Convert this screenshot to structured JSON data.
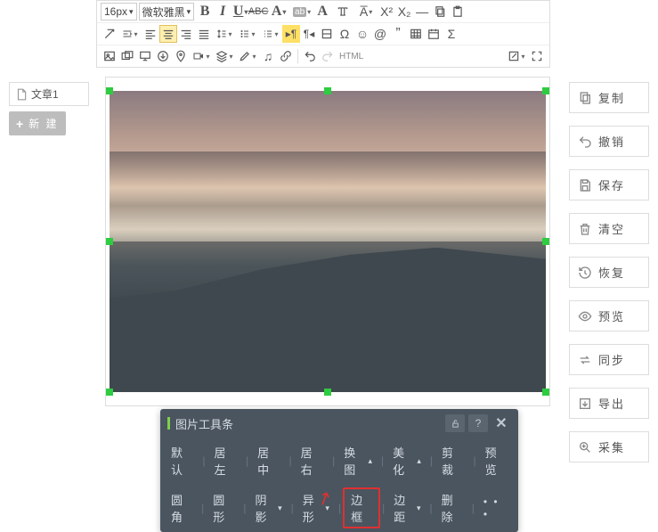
{
  "toolbar": {
    "font_size": "16px",
    "font_family": "微软雅黑",
    "html_label": "HTML"
  },
  "left": {
    "doc_tab": "文章1",
    "new_btn": "新 建"
  },
  "right": {
    "copy": "复制",
    "undo": "撤销",
    "save": "保存",
    "clear": "清空",
    "restore": "恢复",
    "preview": "预览",
    "sync": "同步",
    "export": "导出",
    "collect": "采集"
  },
  "float": {
    "title": "图片工具条",
    "help": "?",
    "row1": {
      "default": "默认",
      "align_left": "居左",
      "align_center": "居中",
      "align_right": "居右",
      "replace": "换图",
      "beautify": "美化",
      "crop": "剪裁",
      "preview": "预览"
    },
    "row2": {
      "rounded": "圆角",
      "circle": "圆形",
      "shadow": "阴影",
      "deform": "异形",
      "border": "边框",
      "margin": "边距",
      "delete": "删除",
      "more": "• • •"
    }
  }
}
